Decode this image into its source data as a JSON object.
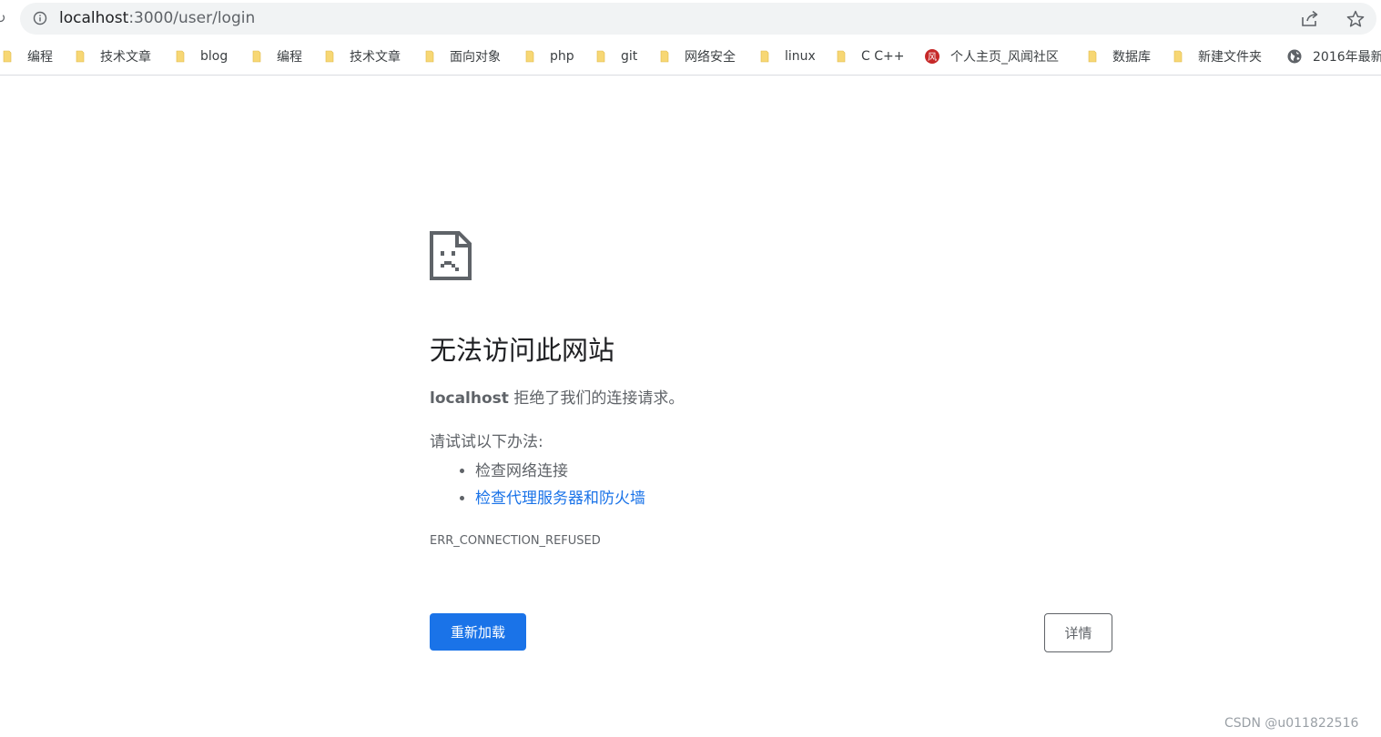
{
  "browser": {
    "address_bar": {
      "url_host": "localhost",
      "url_rest": ":3000/user/login"
    },
    "bookmarks": [
      {
        "label": "编程",
        "icon": "folder-icon"
      },
      {
        "label": "技术文章",
        "icon": "folder-icon"
      },
      {
        "label": "blog",
        "icon": "folder-icon"
      },
      {
        "label": "编程",
        "icon": "folder-icon"
      },
      {
        "label": "技术文章",
        "icon": "folder-icon"
      },
      {
        "label": "面向对象",
        "icon": "folder-icon"
      },
      {
        "label": "php",
        "icon": "folder-icon"
      },
      {
        "label": "git",
        "icon": "folder-icon"
      },
      {
        "label": "网络安全",
        "icon": "folder-icon"
      },
      {
        "label": "linux",
        "icon": "folder-icon"
      },
      {
        "label": "C C++",
        "icon": "folder-icon"
      },
      {
        "label": "个人主页_风闻社区",
        "icon": "site-logo-icon",
        "icon_text": "风"
      },
      {
        "label": "数据库",
        "icon": "folder-icon"
      },
      {
        "label": "新建文件夹",
        "icon": "folder-icon"
      },
      {
        "label": "2016年最新",
        "icon": "globe-icon"
      }
    ]
  },
  "error_page": {
    "title": "无法访问此网站",
    "message_host": "localhost",
    "message_rest": " 拒绝了我们的连接请求。",
    "suggestions_heading": "请试试以下办法:",
    "suggestions": [
      {
        "label": "检查网络连接",
        "link": false
      },
      {
        "label": "检查代理服务器和防火墙",
        "link": true
      }
    ],
    "error_code": "ERR_CONNECTION_REFUSED",
    "reload_label": "重新加载",
    "details_label": "详情"
  },
  "watermark": "CSDN @u011822516",
  "colors": {
    "primary_button": "#1a73e8",
    "link": "#1a73e8",
    "folder": "#f7d774",
    "site_logo": "#c62828",
    "text_secondary": "#5f6368"
  }
}
